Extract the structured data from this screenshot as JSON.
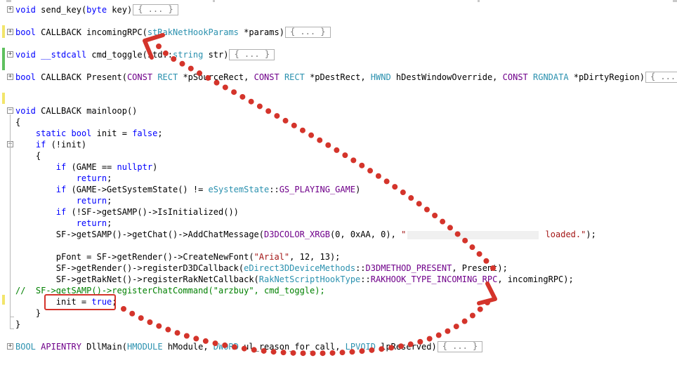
{
  "editor": {
    "lines": [
      {
        "name": "code-line-send-key",
        "tokens": [
          [
            "kw",
            "void"
          ],
          [
            "",
            "",
            " "
          ],
          [
            "",
            "send_key("
          ],
          [
            "kw",
            "byte"
          ],
          [
            "",
            " key)"
          ]
        ],
        "collapsed": "{ ... }"
      },
      {
        "name": "code-line-incoming-rpc",
        "tokens": [
          [
            "kw",
            "bool"
          ],
          [
            "",
            " CALLBACK incomingRPC("
          ],
          [
            "ty",
            "stRakNetHookParams"
          ],
          [
            "",
            " *params)"
          ]
        ],
        "collapsed": "{ ... }"
      },
      {
        "name": "code-line-cmd-toggle",
        "tokens": [
          [
            "kw",
            "void"
          ],
          [
            "",
            " "
          ],
          [
            "kw",
            "__stdcall"
          ],
          [
            "",
            " cmd_toggle("
          ],
          [
            "",
            "std::"
          ],
          [
            "ty",
            "string"
          ],
          [
            "",
            " str)"
          ]
        ],
        "collapsed": "{ ... }"
      },
      {
        "name": "code-line-present",
        "tokens": [
          [
            "kw",
            "bool"
          ],
          [
            "",
            " CALLBACK Present("
          ],
          [
            "mac",
            "CONST"
          ],
          [
            "",
            " "
          ],
          [
            "ty",
            "RECT"
          ],
          [
            "",
            " *pSourceRect, "
          ],
          [
            "mac",
            "CONST"
          ],
          [
            "",
            " "
          ],
          [
            "ty",
            "RECT"
          ],
          [
            "",
            " *pDestRect, "
          ],
          [
            "ty",
            "HWND"
          ],
          [
            "",
            " hDestWindowOverride, "
          ],
          [
            "mac",
            "CONST"
          ],
          [
            "",
            " "
          ],
          [
            "ty",
            "RGNDATA"
          ],
          [
            "",
            " *pDirtyRegion)"
          ]
        ],
        "collapsed": "{ ... }"
      },
      {
        "name": "code-line-mainloop",
        "tokens": [
          [
            "kw",
            "void"
          ],
          [
            "",
            " CALLBACK mainloop()"
          ]
        ]
      },
      {
        "name": "code-line-open-brace-1",
        "tokens": [
          [
            "",
            "{"
          ]
        ]
      },
      {
        "name": "code-line-static-init",
        "tokens": [
          [
            "",
            "    "
          ],
          [
            "kw",
            "static"
          ],
          [
            "",
            " "
          ],
          [
            "kw",
            "bool"
          ],
          [
            "",
            " init = "
          ],
          [
            "kw",
            "false"
          ],
          [
            "",
            ";"
          ]
        ]
      },
      {
        "name": "code-line-if-not-init",
        "tokens": [
          [
            "",
            "    "
          ],
          [
            "kw",
            "if"
          ],
          [
            "",
            " (!init)"
          ]
        ]
      },
      {
        "name": "code-line-open-brace-2",
        "tokens": [
          [
            "",
            "    {"
          ]
        ]
      },
      {
        "name": "code-line-if-game-null",
        "tokens": [
          [
            "",
            "        "
          ],
          [
            "kw",
            "if"
          ],
          [
            "",
            " (GAME == "
          ],
          [
            "kw",
            "nullptr"
          ],
          [
            "",
            ")"
          ]
        ]
      },
      {
        "name": "code-line-return-1",
        "tokens": [
          [
            "",
            "            "
          ],
          [
            "kw",
            "return"
          ],
          [
            "",
            ";"
          ]
        ]
      },
      {
        "name": "code-line-if-system-state",
        "tokens": [
          [
            "",
            "        "
          ],
          [
            "kw",
            "if"
          ],
          [
            "",
            " (GAME->GetSystemState() != "
          ],
          [
            "ty",
            "eSystemState"
          ],
          [
            "",
            "::"
          ],
          [
            "mac",
            "GS_PLAYING_GAME"
          ],
          [
            "",
            ")"
          ]
        ]
      },
      {
        "name": "code-line-return-2",
        "tokens": [
          [
            "",
            "            "
          ],
          [
            "kw",
            "return"
          ],
          [
            "",
            ";"
          ]
        ]
      },
      {
        "name": "code-line-if-initialized",
        "tokens": [
          [
            "",
            "        "
          ],
          [
            "kw",
            "if"
          ],
          [
            "",
            " (!SF->getSAMP()->IsInitialized())"
          ]
        ]
      },
      {
        "name": "code-line-return-3",
        "tokens": [
          [
            "",
            "            "
          ],
          [
            "kw",
            "return"
          ],
          [
            "",
            ";"
          ]
        ]
      },
      {
        "name": "code-line-add-chat-message",
        "tokens": [
          [
            "",
            "        SF->getSAMP()->getChat()->AddChatMessage("
          ],
          [
            "mac",
            "D3DCOLOR_XRGB"
          ],
          [
            "",
            "(0, 0xAA, 0), "
          ],
          [
            "str",
            "\""
          ],
          [
            "blur",
            ""
          ],
          [
            "str",
            " loaded.\""
          ],
          [
            "",
            ");"
          ]
        ]
      },
      {
        "name": "code-line-blank",
        "tokens": [
          [
            "",
            ""
          ]
        ]
      },
      {
        "name": "code-line-create-font",
        "tokens": [
          [
            "",
            "        pFont = SF->getRender()->CreateNewFont("
          ],
          [
            "str",
            "\"Arial\""
          ],
          [
            "",
            ", 12, 13);"
          ]
        ]
      },
      {
        "name": "code-line-register-d3d",
        "tokens": [
          [
            "",
            "        SF->getRender()->registerD3DCallback("
          ],
          [
            "ty",
            "eDirect3DDeviceMethods"
          ],
          [
            "",
            "::"
          ],
          [
            "mac",
            "D3DMETHOD_PRESENT"
          ],
          [
            "",
            ", Present);"
          ]
        ]
      },
      {
        "name": "code-line-register-raknet",
        "tokens": [
          [
            "",
            "        SF->getRakNet()->registerRakNetCallback("
          ],
          [
            "ty",
            "RakNetScriptHookType"
          ],
          [
            "",
            "::"
          ],
          [
            "mac",
            "RAKHOOK_TYPE_INCOMING_RPC"
          ],
          [
            "",
            ", incomingRPC);"
          ]
        ]
      },
      {
        "name": "code-line-commented-register",
        "tokens": [
          [
            "cm",
            "//  SF->getSAMP()->registerChatCommand(\"arzbuy\", cmd_toggle);"
          ]
        ]
      },
      {
        "name": "code-line-init-true",
        "tokens": [
          [
            "",
            "        init = "
          ],
          [
            "kw",
            "true"
          ],
          [
            "",
            ";"
          ]
        ]
      },
      {
        "name": "code-line-close-brace-2",
        "tokens": [
          [
            "",
            "    }"
          ]
        ]
      },
      {
        "name": "code-line-close-brace-1",
        "tokens": [
          [
            "",
            "}"
          ]
        ]
      },
      {
        "name": "code-line-dllmain",
        "tokens": [
          [
            "ty",
            "BOOL"
          ],
          [
            "",
            " "
          ],
          [
            "mac",
            "APIENTRY"
          ],
          [
            "",
            " DllMain("
          ],
          [
            "ty",
            "HMODULE"
          ],
          [
            "",
            " hModule, "
          ],
          [
            "ty",
            "DWORD"
          ],
          [
            "",
            " ul_reason_for_call, "
          ],
          [
            "ty",
            "LPVOID"
          ],
          [
            "",
            " lpReserved)"
          ]
        ],
        "collapsed": "{ ... }"
      }
    ]
  },
  "colors": {
    "keyword": "#0000ff",
    "type": "#2b91af",
    "string": "#a31515",
    "comment": "#008000",
    "macro": "#6f008a",
    "annotation": "#d4342b"
  }
}
